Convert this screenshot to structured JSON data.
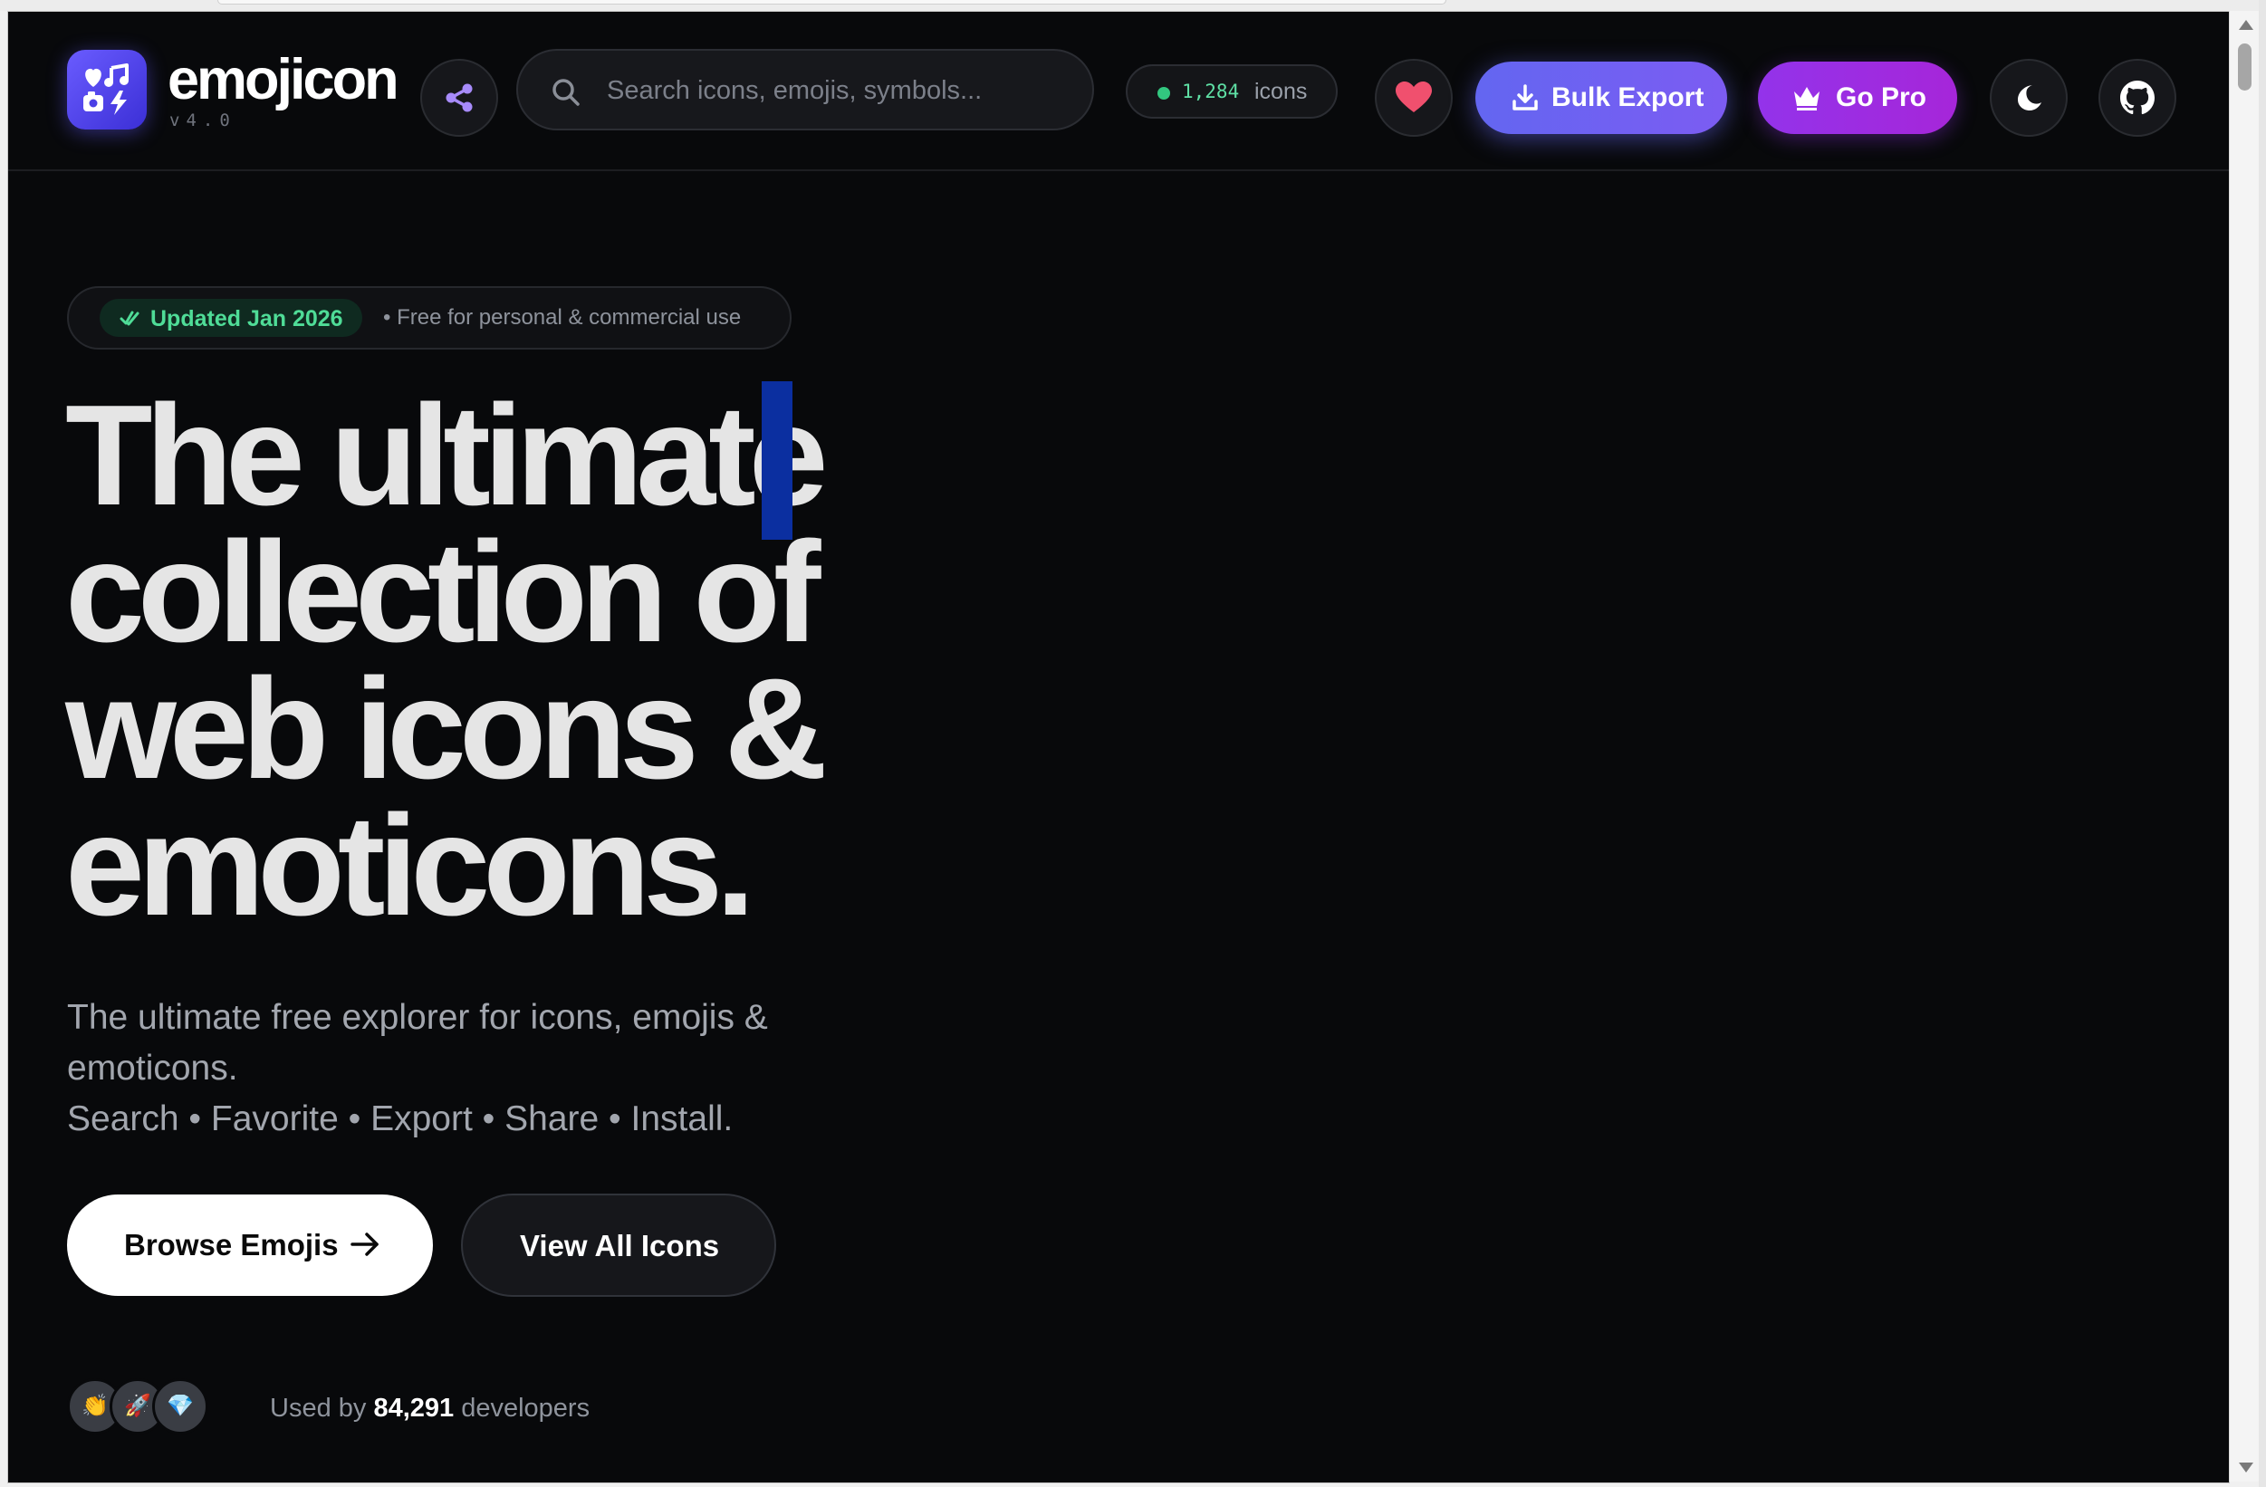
{
  "app": {
    "brand": "emojicon",
    "version": "v4.0"
  },
  "header": {
    "search_placeholder": "Search icons, emojis, symbols...",
    "icon_count": "1,284",
    "icon_count_label": "icons",
    "bulk_export_label": "Bulk Export",
    "go_pro_label": "Go Pro"
  },
  "icons": {
    "logo": "logo-icon",
    "share": "share-icon",
    "search": "search-icon",
    "favorites": "heart-icon",
    "download": "download-icon",
    "crown": "crown-icon",
    "theme": "moon-icon",
    "github": "github-icon",
    "check": "check-icon",
    "arrow": "arrow-right-icon"
  },
  "colors": {
    "background": "#08090b",
    "bulk_export": "#6366f1",
    "go_pro": "#9333ea",
    "accent_green": "#4fdc97",
    "heart": "#f0506e"
  },
  "hero": {
    "badge_updated": "Updated Jan 2026",
    "badge_rest": "• Free for personal & commercial use",
    "headline_lines": [
      "The ultimate",
      "collection of",
      "web icons &",
      "emoticons."
    ],
    "subtitle_lines": [
      "The ultimate free explorer for icons, emojis &",
      "emoticons.",
      "Search • Favorite • Export • Share • Install."
    ],
    "primary_button": "Browse Emojis",
    "secondary_button": "View All Icons",
    "avatars": [
      "👏",
      "🚀",
      "💎"
    ],
    "used_prefix": "Used by",
    "used_count": "84,291",
    "used_suffix": "developers"
  }
}
